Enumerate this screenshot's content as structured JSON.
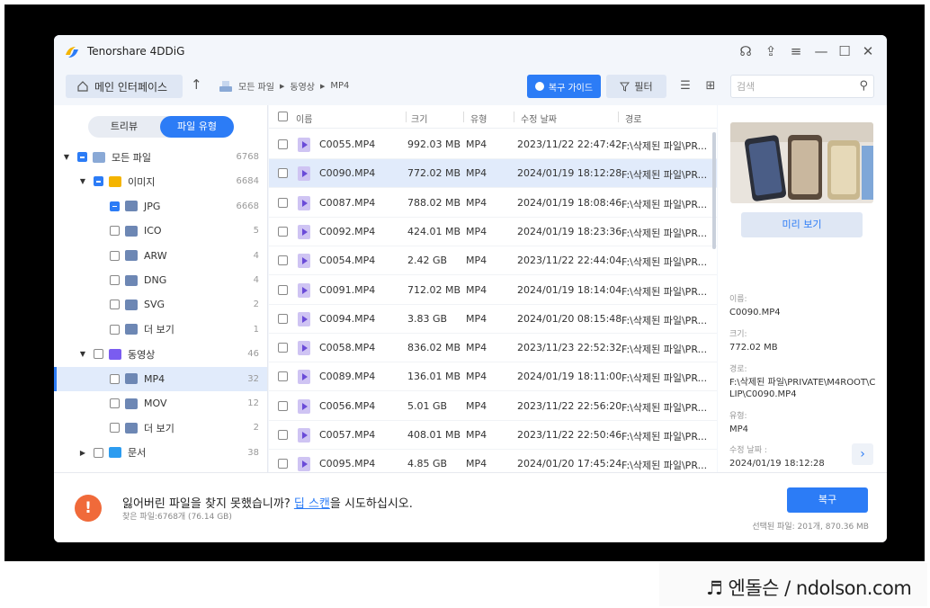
{
  "app": {
    "title": "Tenorshare 4DDiG"
  },
  "window_controls": [
    "headset-icon",
    "share-icon",
    "menu-icon",
    "minimize-icon",
    "maximize-icon",
    "close-icon"
  ],
  "toolbar": {
    "home_label": "메인 인터페이스",
    "breadcrumb": [
      "모든 파일",
      "동영상",
      "MP4"
    ],
    "guide_label": "복구 가이드",
    "filter_label": "필터",
    "search_placeholder": "검색"
  },
  "left_panel": {
    "tabs": [
      "트리뷰",
      "파일 유형"
    ],
    "active_tab": "파일 유형",
    "tree": [
      {
        "label": "모든 파일",
        "count": "6768",
        "level": 0,
        "arrow": "▼",
        "check": "partial",
        "icon": "drive-icon"
      },
      {
        "label": "이미지",
        "count": "6684",
        "level": 1,
        "arrow": "▼",
        "check": "partial",
        "icon": "image-folder-icon"
      },
      {
        "label": "JPG",
        "count": "6668",
        "level": 2,
        "arrow": "",
        "check": "partial",
        "icon": "folder-icon"
      },
      {
        "label": "ICO",
        "count": "5",
        "level": 2,
        "arrow": "",
        "check": "none",
        "icon": "folder-icon"
      },
      {
        "label": "ARW",
        "count": "4",
        "level": 2,
        "arrow": "",
        "check": "none",
        "icon": "folder-icon"
      },
      {
        "label": "DNG",
        "count": "4",
        "level": 2,
        "arrow": "",
        "check": "none",
        "icon": "folder-icon"
      },
      {
        "label": "SVG",
        "count": "2",
        "level": 2,
        "arrow": "",
        "check": "none",
        "icon": "folder-icon"
      },
      {
        "label": "더 보기",
        "count": "1",
        "level": 2,
        "arrow": "",
        "check": "none",
        "icon": "folder-icon"
      },
      {
        "label": "동영상",
        "count": "46",
        "level": 1,
        "arrow": "▼",
        "check": "none",
        "icon": "video-folder-icon"
      },
      {
        "label": "MP4",
        "count": "32",
        "level": 2,
        "arrow": "",
        "check": "none",
        "icon": "folder-icon",
        "selected": true
      },
      {
        "label": "MOV",
        "count": "12",
        "level": 2,
        "arrow": "",
        "check": "none",
        "icon": "folder-icon"
      },
      {
        "label": "더 보기",
        "count": "2",
        "level": 2,
        "arrow": "",
        "check": "none",
        "icon": "folder-icon"
      },
      {
        "label": "문서",
        "count": "38",
        "level": 1,
        "arrow": "▶",
        "check": "none",
        "icon": "document-folder-icon"
      }
    ]
  },
  "file_list": {
    "columns": [
      "이름",
      "크기",
      "유형",
      "수정 날짜",
      "경로"
    ],
    "rows": [
      {
        "name": "C0055.MP4",
        "size": "992.03 MB",
        "type": "MP4",
        "date": "2023/11/22 22:47:42",
        "path": "F:\\삭제된 파일\\PR..."
      },
      {
        "name": "C0090.MP4",
        "size": "772.02 MB",
        "type": "MP4",
        "date": "2024/01/19 18:12:28",
        "path": "F:\\삭제된 파일\\PR...",
        "selected": true
      },
      {
        "name": "C0087.MP4",
        "size": "788.02 MB",
        "type": "MP4",
        "date": "2024/01/19 18:08:46",
        "path": "F:\\삭제된 파일\\PR..."
      },
      {
        "name": "C0092.MP4",
        "size": "424.01 MB",
        "type": "MP4",
        "date": "2024/01/19 18:23:36",
        "path": "F:\\삭제된 파일\\PR..."
      },
      {
        "name": "C0054.MP4",
        "size": "2.42 GB",
        "type": "MP4",
        "date": "2023/11/22 22:44:04",
        "path": "F:\\삭제된 파일\\PR..."
      },
      {
        "name": "C0091.MP4",
        "size": "712.02 MB",
        "type": "MP4",
        "date": "2024/01/19 18:14:04",
        "path": "F:\\삭제된 파일\\PR..."
      },
      {
        "name": "C0094.MP4",
        "size": "3.83 GB",
        "type": "MP4",
        "date": "2024/01/20 08:15:48",
        "path": "F:\\삭제된 파일\\PR..."
      },
      {
        "name": "C0058.MP4",
        "size": "836.02 MB",
        "type": "MP4",
        "date": "2023/11/23 22:52:32",
        "path": "F:\\삭제된 파일\\PR..."
      },
      {
        "name": "C0089.MP4",
        "size": "136.01 MB",
        "type": "MP4",
        "date": "2024/01/19 18:11:00",
        "path": "F:\\삭제된 파일\\PR..."
      },
      {
        "name": "C0056.MP4",
        "size": "5.01 GB",
        "type": "MP4",
        "date": "2023/11/22 22:56:20",
        "path": "F:\\삭제된 파일\\PR..."
      },
      {
        "name": "C0057.MP4",
        "size": "408.01 MB",
        "type": "MP4",
        "date": "2023/11/22 22:50:46",
        "path": "F:\\삭제된 파일\\PR..."
      },
      {
        "name": "C0095.MP4",
        "size": "4.85 GB",
        "type": "MP4",
        "date": "2024/01/20 17:45:24",
        "path": "F:\\삭제된 파일\\PR..."
      }
    ]
  },
  "preview": {
    "button_label": "미리 보기",
    "name_label": "이름:",
    "name_value": "C0090.MP4",
    "size_label": "크기:",
    "size_value": "772.02 MB",
    "path_label": "경로:",
    "path_value": "F:\\삭제된 파일\\PRIVATE\\M4ROOT\\CLIP\\C0090.MP4",
    "type_label": "유형:",
    "type_value": "MP4",
    "date_label": "수정 날짜 :",
    "date_value": "2024/01/19 18:12:28"
  },
  "footer": {
    "message_before": "잃어버린 파일을 찾지 못했습니까? ",
    "message_link": "딥 스캔",
    "message_after": "을 시도하십시오.",
    "found_info": "찾은 파일:6768개 (76.14 GB)",
    "recover_label": "복구",
    "selected_info": "선택된 파일: 201개, 870.36 MB"
  },
  "watermark": {
    "text": "♬ 엔돌슨 / ndolson.com"
  },
  "colors": {
    "accent": "#2c7cf6",
    "selected_row": "#e1ebfb",
    "warning": "#f06a3a"
  }
}
